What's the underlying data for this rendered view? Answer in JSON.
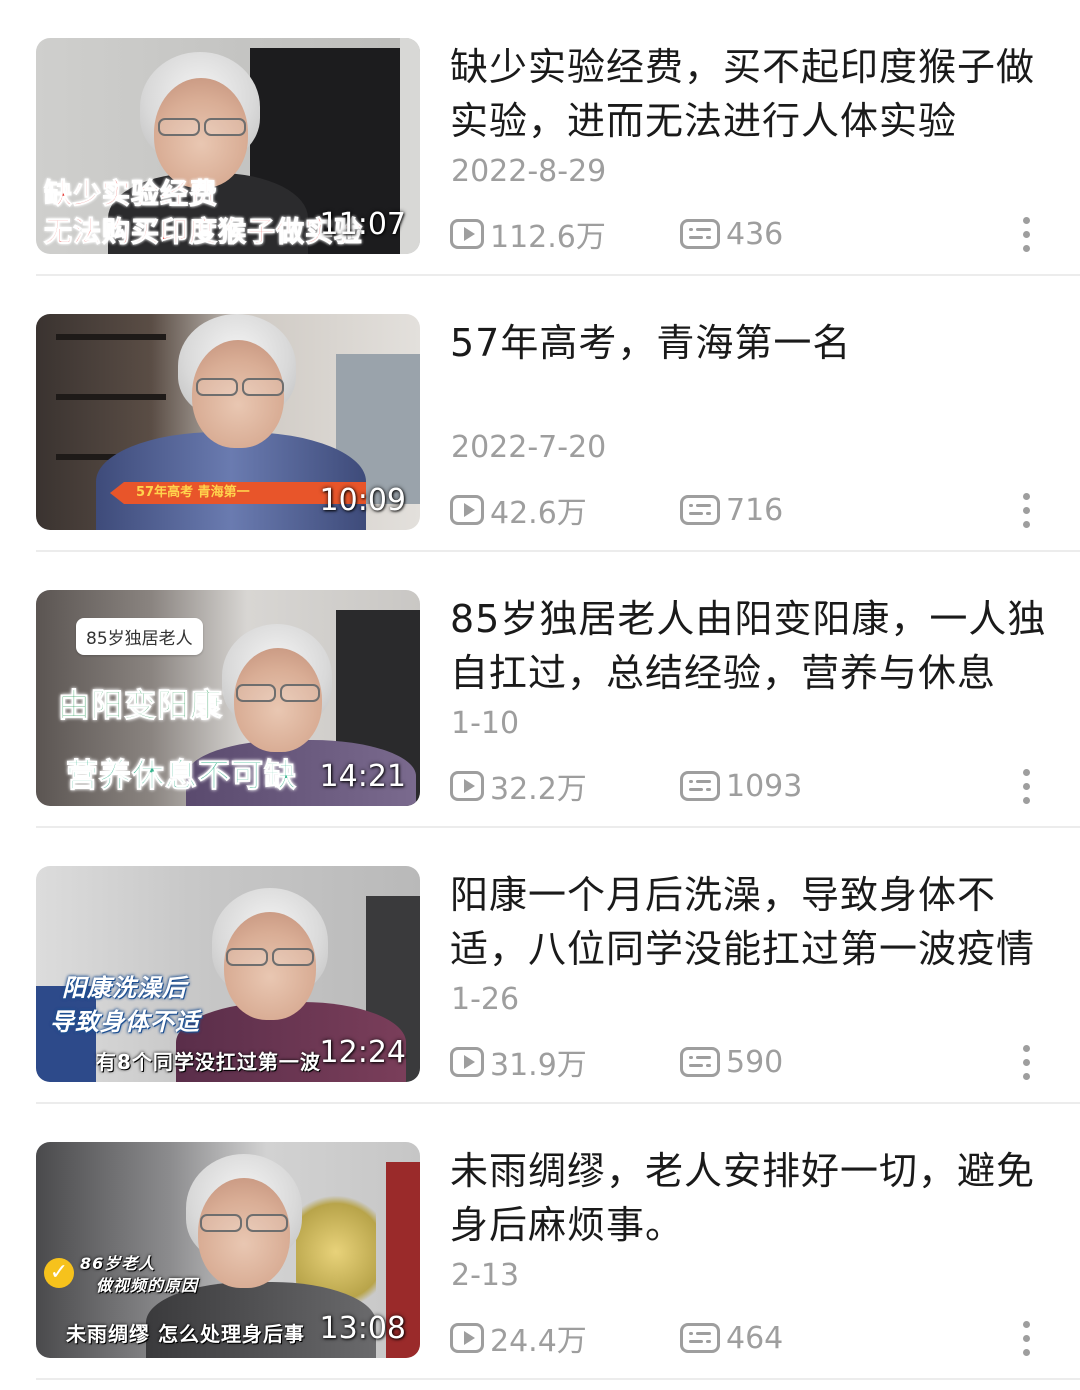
{
  "videos": [
    {
      "title": "缺少实验经费，买不起印度猴子做实验，进而无法进行人体实验",
      "date": "2022-8-29",
      "duration": "11:07",
      "views": "112.6万",
      "comments": "436",
      "thumb_captions": [
        "缺少实验经费",
        "无法购买印度猴子做实验"
      ]
    },
    {
      "title": "57年高考，青海第一名",
      "date": "2022-7-20",
      "duration": "10:09",
      "views": "42.6万",
      "comments": "716",
      "thumb_captions": [
        "57年高考 青海第一"
      ]
    },
    {
      "title": "85岁独居老人由阳变阳康，一人独自扛过，总结经验，营养与休息",
      "date": "1-10",
      "duration": "14:21",
      "views": "32.2万",
      "comments": "1093",
      "thumb_captions": [
        "85岁独居老人",
        "由阳变阳康",
        "营养休息不可缺"
      ]
    },
    {
      "title": "阳康一个月后洗澡，导致身体不适，八位同学没能扛过第一波疫情",
      "date": "1-26",
      "duration": "12:24",
      "views": "31.9万",
      "comments": "590",
      "thumb_captions": [
        "阳康洗澡后",
        "导致身体不适",
        "有8个同学没扛过第一波"
      ]
    },
    {
      "title": "未雨绸缪，老人安排好一切，避免身后麻烦事。",
      "date": "2-13",
      "duration": "13:08",
      "views": "24.4万",
      "comments": "464",
      "thumb_captions": [
        "86岁老人",
        "做视频的原因",
        "未雨绸缪 怎么处理身后事"
      ]
    }
  ],
  "icons": {
    "views": "play-count-icon",
    "comments": "danmaku-comment-icon",
    "more": "more-vertical-icon"
  },
  "colors": {
    "meta_gray": "#9e9e9e",
    "title_text": "#1a1a1a",
    "divider": "#ececec"
  }
}
